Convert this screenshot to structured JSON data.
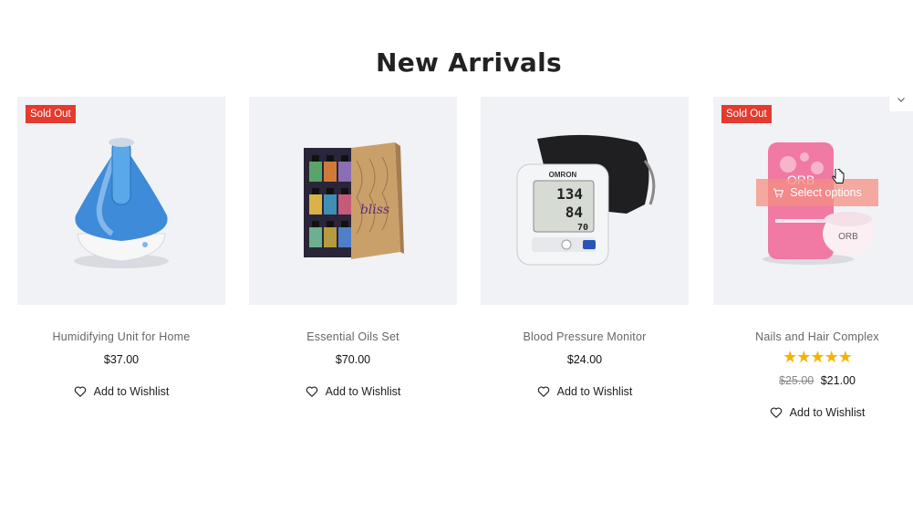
{
  "section": {
    "title": "New Arrivals"
  },
  "products": [
    {
      "title": "Humidifying Unit for Home",
      "price": "$37.00",
      "badge": "Sold Out",
      "wishlist": "Add to Wishlist"
    },
    {
      "title": "Essential Oils Set",
      "price": "$70.00",
      "wishlist": "Add to Wishlist"
    },
    {
      "title": "Blood Pressure Monitor",
      "price": "$24.00",
      "wishlist": "Add to Wishlist"
    },
    {
      "title": "Nails and Hair Complex",
      "old_price": "$25.00",
      "price": "$21.00",
      "badge": "Sold Out",
      "rating": 5,
      "select_options": "Select options",
      "wishlist": "Add to Wishlist"
    }
  ],
  "monitor_display": {
    "brand": "OMRON",
    "sys": "134",
    "dia": "84",
    "pulse": "70"
  },
  "orb_label": "ORB",
  "oils_box_label": "bliss",
  "colors": {
    "badge": "#e43b2e",
    "star": "#f5b301",
    "card_bg": "#f1f2f6",
    "overlay": "#f48f82"
  }
}
